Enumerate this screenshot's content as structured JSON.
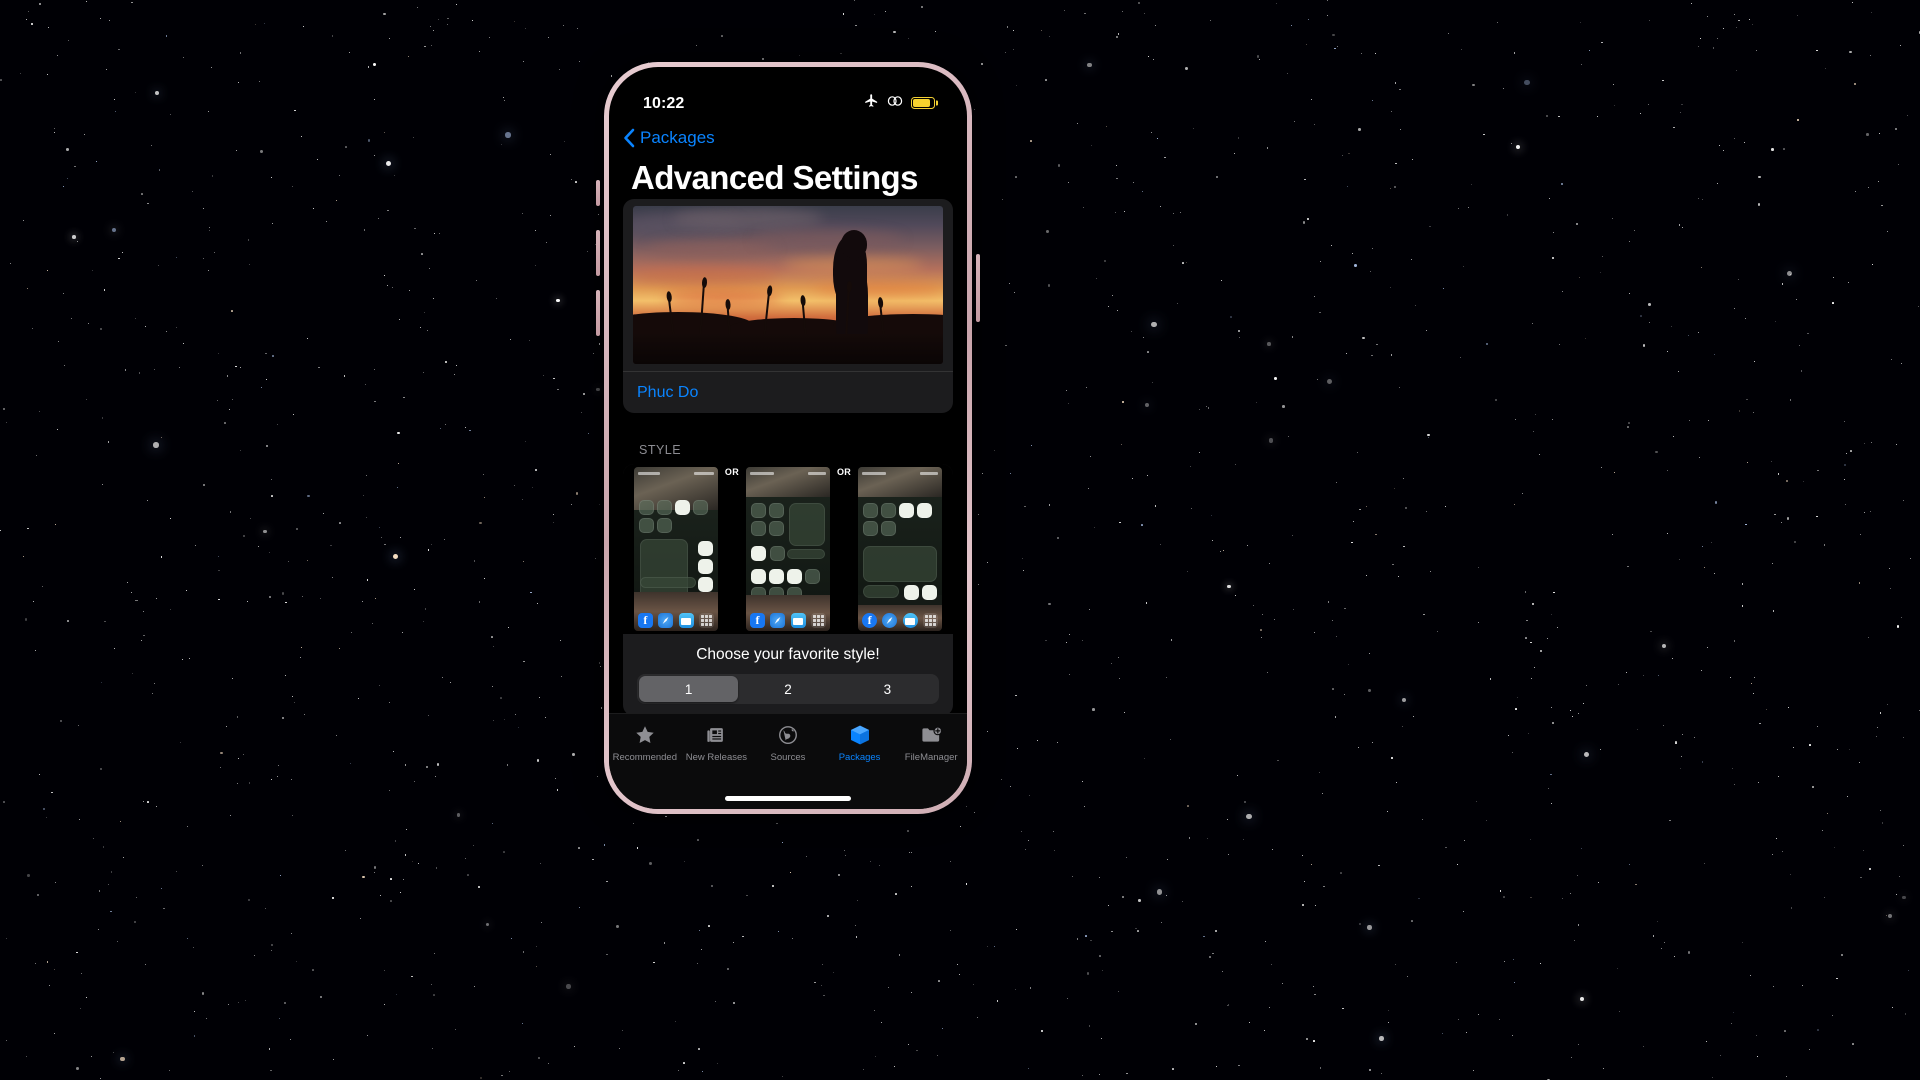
{
  "wallpaper": {
    "description": "black starfield night sky"
  },
  "phone": {
    "status_bar": {
      "time": "10:22",
      "icons": [
        {
          "name": "airplane-mode-icon",
          "label": "Airplane Mode"
        },
        {
          "name": "link-icon",
          "label": "Link"
        },
        {
          "name": "battery-icon",
          "label": "Battery Low Power Mode",
          "color": "#f7d32e"
        }
      ]
    },
    "nav": {
      "back_label": "Packages",
      "back_icon": "chevron-left-icon",
      "accent": "#0a84ff"
    },
    "page_title": "Advanced Settings",
    "package_card": {
      "banner_alt": "Anime girl silhouette at sunset",
      "author": "Phuc Do"
    },
    "style_section": {
      "header": "STYLE",
      "previews": [
        {
          "index": 1,
          "alt": "Control center style 1 preview"
        },
        {
          "index": 2,
          "alt": "Control center style 2 preview"
        },
        {
          "index": 3,
          "alt": "Control center style 3 preview"
        }
      ],
      "separator_label": "OR",
      "prompt": "Choose your favorite style!",
      "segmented": {
        "options": [
          "1",
          "2",
          "3"
        ],
        "selected_index": 0
      }
    },
    "tab_bar": {
      "items": [
        {
          "label": "Recommended",
          "icon": "star-icon",
          "active": false
        },
        {
          "label": "New Releases",
          "icon": "news-icon",
          "active": false
        },
        {
          "label": "Sources",
          "icon": "globe-icon",
          "active": false
        },
        {
          "label": "Packages",
          "icon": "package-icon",
          "active": true
        },
        {
          "label": "FileManager",
          "icon": "folder-plus-icon",
          "active": false
        }
      ],
      "active_color": "#0a84ff",
      "inactive_color": "#8e8e93"
    }
  }
}
